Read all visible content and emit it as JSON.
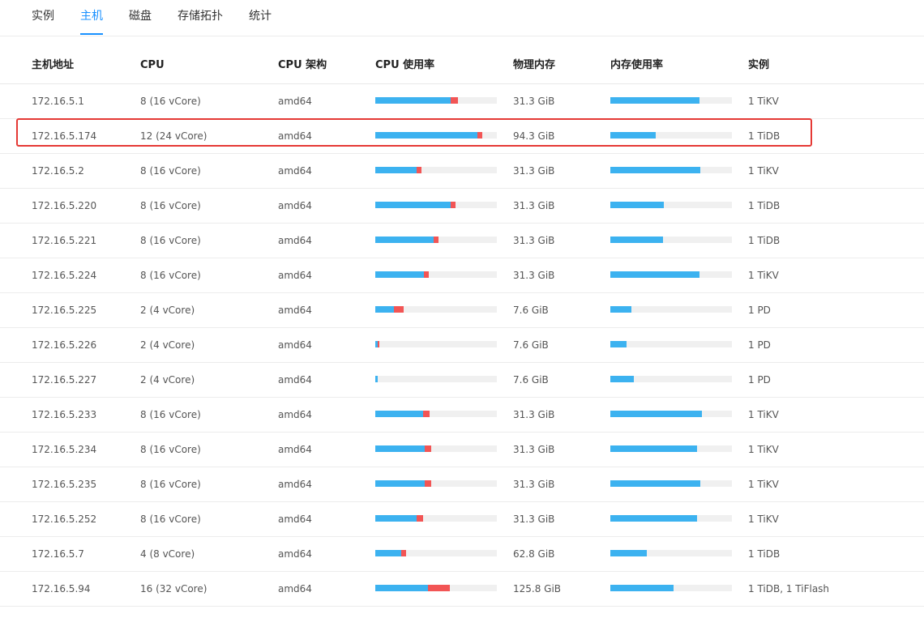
{
  "tabs": [
    {
      "label": "实例",
      "active": false
    },
    {
      "label": "主机",
      "active": true
    },
    {
      "label": "磁盘",
      "active": false
    },
    {
      "label": "存储拓扑",
      "active": false
    },
    {
      "label": "统计",
      "active": false
    }
  ],
  "columns": [
    "主机地址",
    "CPU",
    "CPU 架构",
    "CPU 使用率",
    "物理内存",
    "内存使用率",
    "实例"
  ],
  "colors": {
    "accent": "#1890ff",
    "usage_user": "#3cb2f0",
    "usage_system": "#f25555",
    "highlight": "#e53935"
  },
  "highlighted_row": 1,
  "rows": [
    {
      "address": "172.16.5.1",
      "cpu": "8 (16 vCore)",
      "arch": "amd64",
      "cpu_user": 0.62,
      "cpu_sys": 0.06,
      "memory": "31.3 GiB",
      "mem_usage": 0.73,
      "instances": "1 TiKV"
    },
    {
      "address": "172.16.5.174",
      "cpu": "12 (24 vCore)",
      "arch": "amd64",
      "cpu_user": 0.84,
      "cpu_sys": 0.04,
      "memory": "94.3 GiB",
      "mem_usage": 0.37,
      "instances": "1 TiDB"
    },
    {
      "address": "172.16.5.2",
      "cpu": "8 (16 vCore)",
      "arch": "amd64",
      "cpu_user": 0.34,
      "cpu_sys": 0.04,
      "memory": "31.3 GiB",
      "mem_usage": 0.74,
      "instances": "1 TiKV"
    },
    {
      "address": "172.16.5.220",
      "cpu": "8 (16 vCore)",
      "arch": "amd64",
      "cpu_user": 0.62,
      "cpu_sys": 0.04,
      "memory": "31.3 GiB",
      "mem_usage": 0.44,
      "instances": "1 TiDB"
    },
    {
      "address": "172.16.5.221",
      "cpu": "8 (16 vCore)",
      "arch": "amd64",
      "cpu_user": 0.48,
      "cpu_sys": 0.04,
      "memory": "31.3 GiB",
      "mem_usage": 0.43,
      "instances": "1 TiDB"
    },
    {
      "address": "172.16.5.224",
      "cpu": "8 (16 vCore)",
      "arch": "amd64",
      "cpu_user": 0.4,
      "cpu_sys": 0.04,
      "memory": "31.3 GiB",
      "mem_usage": 0.73,
      "instances": "1 TiKV"
    },
    {
      "address": "172.16.5.225",
      "cpu": "2 (4 vCore)",
      "arch": "amd64",
      "cpu_user": 0.15,
      "cpu_sys": 0.08,
      "memory": "7.6 GiB",
      "mem_usage": 0.17,
      "instances": "1 PD"
    },
    {
      "address": "172.16.5.226",
      "cpu": "2 (4 vCore)",
      "arch": "amd64",
      "cpu_user": 0.02,
      "cpu_sys": 0.01,
      "memory": "7.6 GiB",
      "mem_usage": 0.13,
      "instances": "1 PD"
    },
    {
      "address": "172.16.5.227",
      "cpu": "2 (4 vCore)",
      "arch": "amd64",
      "cpu_user": 0.02,
      "cpu_sys": 0.0,
      "memory": "7.6 GiB",
      "mem_usage": 0.19,
      "instances": "1 PD"
    },
    {
      "address": "172.16.5.233",
      "cpu": "8 (16 vCore)",
      "arch": "amd64",
      "cpu_user": 0.39,
      "cpu_sys": 0.05,
      "memory": "31.3 GiB",
      "mem_usage": 0.75,
      "instances": "1 TiKV"
    },
    {
      "address": "172.16.5.234",
      "cpu": "8 (16 vCore)",
      "arch": "amd64",
      "cpu_user": 0.41,
      "cpu_sys": 0.05,
      "memory": "31.3 GiB",
      "mem_usage": 0.71,
      "instances": "1 TiKV"
    },
    {
      "address": "172.16.5.235",
      "cpu": "8 (16 vCore)",
      "arch": "amd64",
      "cpu_user": 0.41,
      "cpu_sys": 0.05,
      "memory": "31.3 GiB",
      "mem_usage": 0.74,
      "instances": "1 TiKV"
    },
    {
      "address": "172.16.5.252",
      "cpu": "8 (16 vCore)",
      "arch": "amd64",
      "cpu_user": 0.34,
      "cpu_sys": 0.05,
      "memory": "31.3 GiB",
      "mem_usage": 0.71,
      "instances": "1 TiKV"
    },
    {
      "address": "172.16.5.7",
      "cpu": "4 (8 vCore)",
      "arch": "amd64",
      "cpu_user": 0.21,
      "cpu_sys": 0.04,
      "memory": "62.8 GiB",
      "mem_usage": 0.3,
      "instances": "1 TiDB"
    },
    {
      "address": "172.16.5.94",
      "cpu": "16 (32 vCore)",
      "arch": "amd64",
      "cpu_user": 0.43,
      "cpu_sys": 0.18,
      "memory": "125.8 GiB",
      "mem_usage": 0.52,
      "instances": "1 TiDB, 1 TiFlash"
    }
  ]
}
